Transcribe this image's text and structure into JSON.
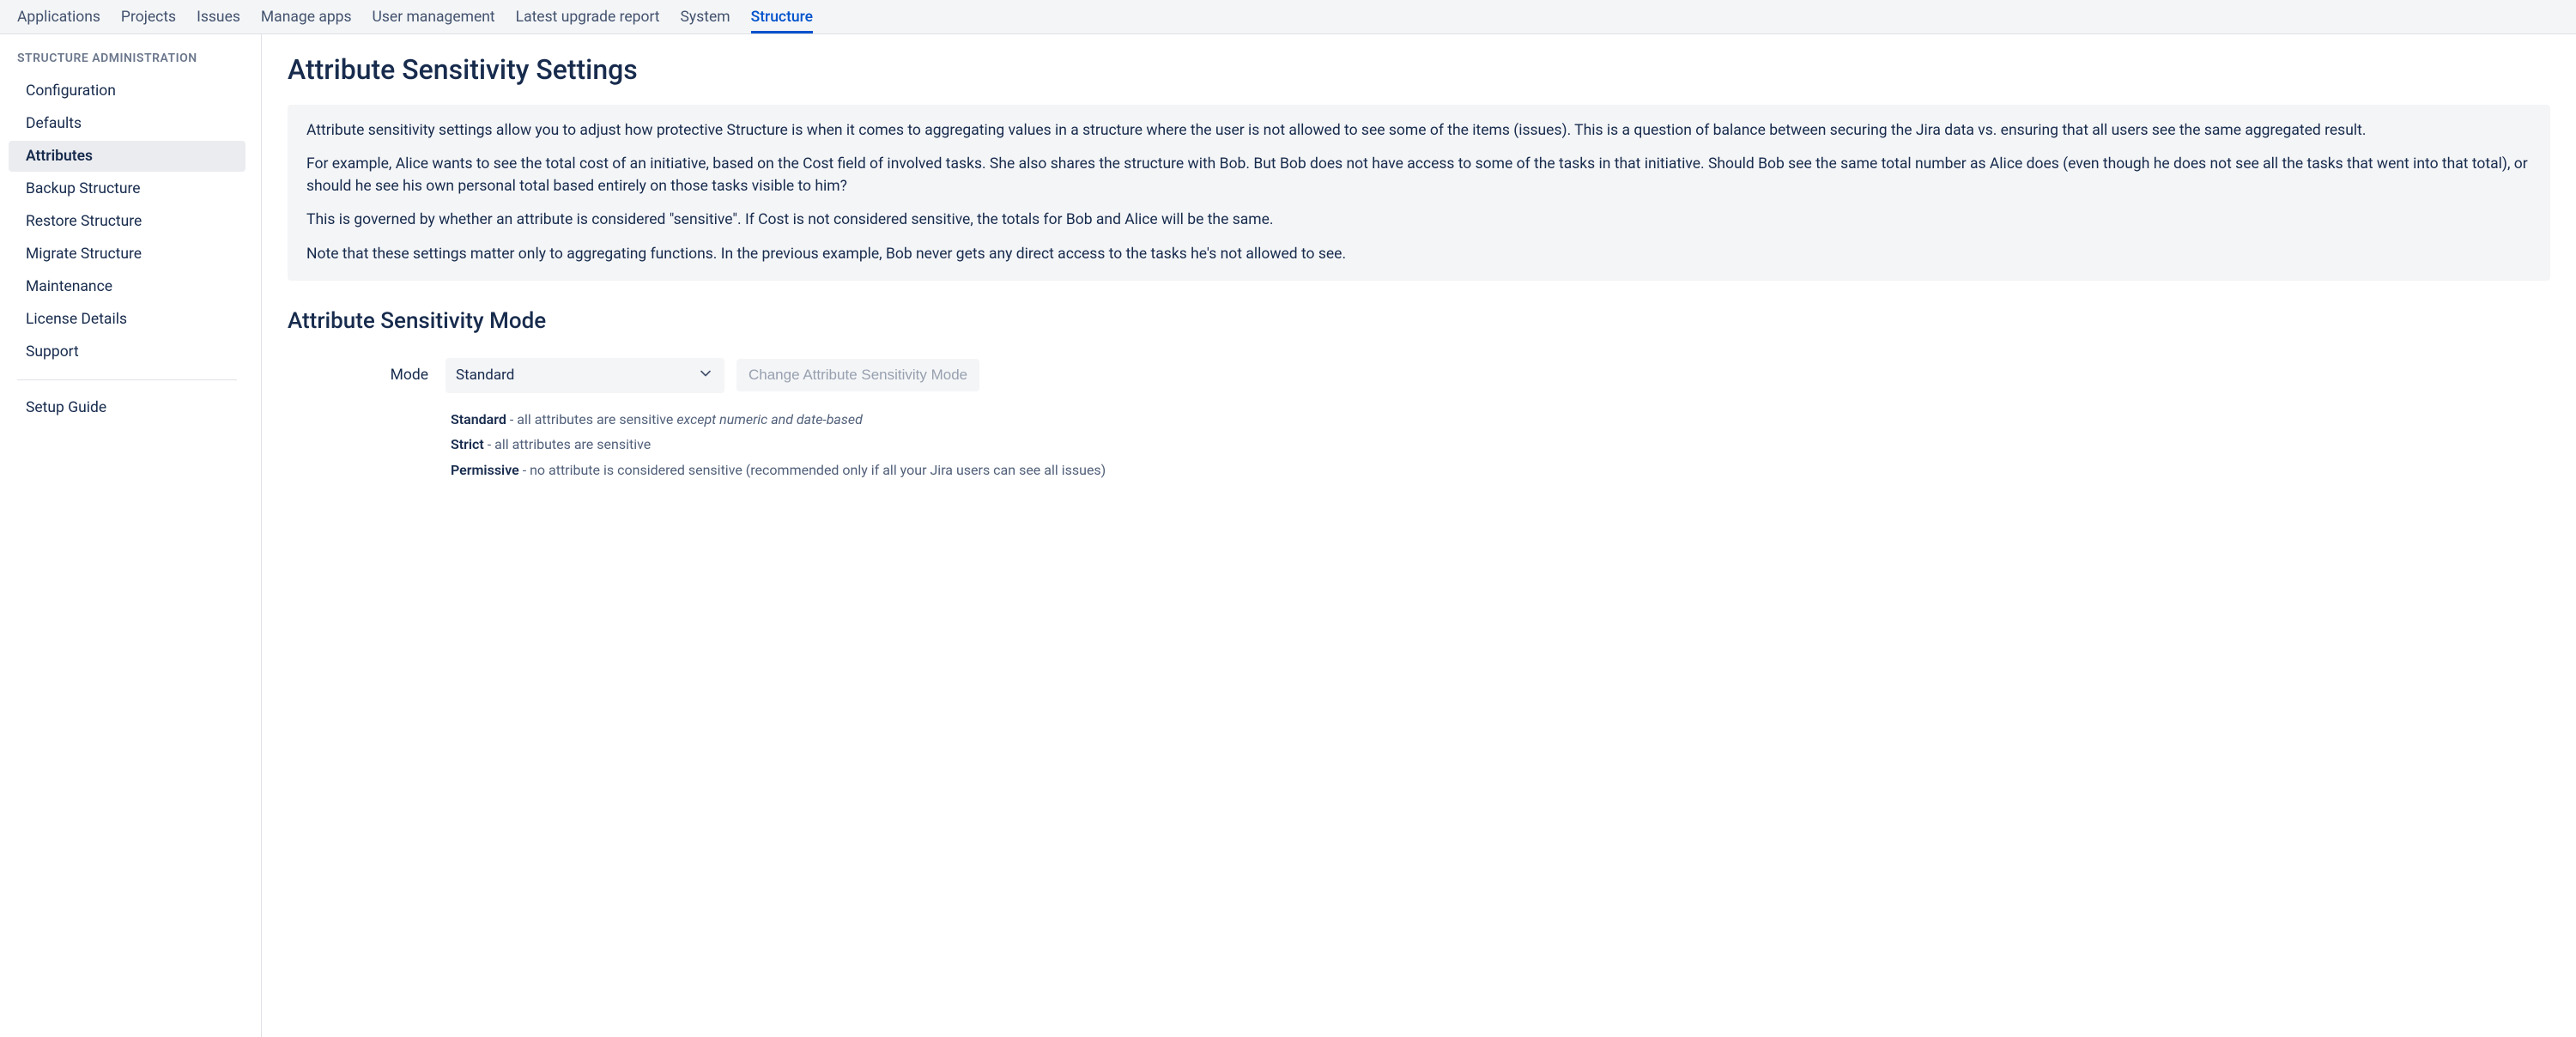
{
  "topnav": {
    "items": [
      "Applications",
      "Projects",
      "Issues",
      "Manage apps",
      "User management",
      "Latest upgrade report",
      "System",
      "Structure"
    ],
    "active_index": 7
  },
  "sidebar": {
    "heading": "STRUCTURE ADMINISTRATION",
    "items": [
      "Configuration",
      "Defaults",
      "Attributes",
      "Backup Structure",
      "Restore Structure",
      "Migrate Structure",
      "Maintenance",
      "License Details",
      "Support"
    ],
    "active_index": 2,
    "items2": [
      "Setup Guide"
    ]
  },
  "main": {
    "title": "Attribute Sensitivity Settings",
    "info_paragraphs": [
      "Attribute sensitivity settings allow you to adjust how protective Structure is when it comes to aggregating values in a structure where the user is not allowed to see some of the items (issues). This is a question of balance between securing the Jira data vs. ensuring that all users see the same aggregated result.",
      "For example, Alice wants to see the total cost of an initiative, based on the Cost field of involved tasks. She also shares the structure with Bob. But Bob does not have access to some of the tasks in that initiative. Should Bob see the same total number as Alice does (even though he does not see all the tasks that went into that total), or should he see his own personal total based entirely on those tasks visible to him?",
      "This is governed by whether an attribute is considered \"sensitive\". If Cost is not considered sensitive, the totals for Bob and Alice will be the same.",
      "Note that these settings matter only to aggregating functions. In the previous example, Bob never gets any direct access to the tasks he's not allowed to see."
    ],
    "section_title": "Attribute Sensitivity Mode",
    "mode_label": "Mode",
    "mode_selected": "Standard",
    "change_button_label": "Change Attribute Sensitivity Mode",
    "mode_descriptions": [
      {
        "name": "Standard",
        "text": " - all attributes are sensitive ",
        "em": "except numeric and date-based"
      },
      {
        "name": "Strict",
        "text": " - all attributes are sensitive",
        "em": ""
      },
      {
        "name": "Permissive",
        "text": " - no attribute is considered sensitive (recommended only if all your Jira users can see all issues)",
        "em": ""
      }
    ]
  }
}
